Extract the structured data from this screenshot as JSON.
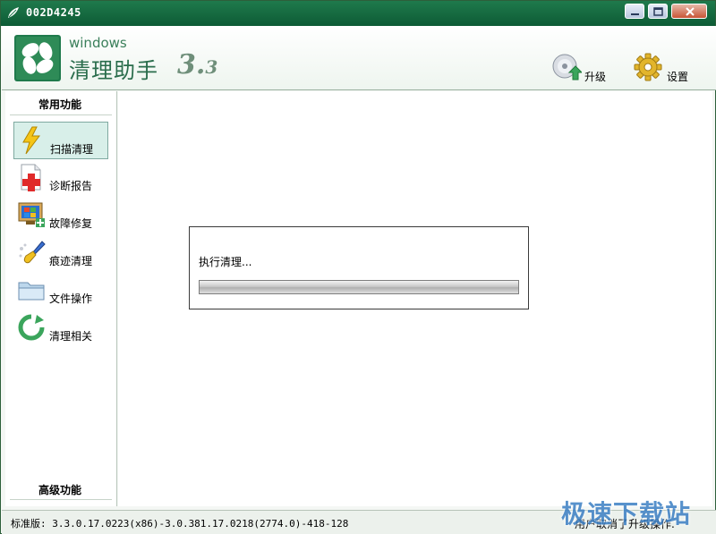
{
  "window": {
    "title": "002D4245"
  },
  "header": {
    "brand_windows": "windows",
    "brand_name": "清理助手",
    "brand_version_major": "3.",
    "brand_version_minor": "3",
    "upgrade_label": "升级",
    "settings_label": "设置"
  },
  "sidebar": {
    "common_header": "常用功能",
    "advanced_header": "高级功能",
    "items": [
      {
        "label": "扫描清理",
        "icon": "lightning-icon",
        "active": true
      },
      {
        "label": "诊断报告",
        "icon": "medical-report-icon",
        "active": false
      },
      {
        "label": "故障修复",
        "icon": "monitor-repair-icon",
        "active": false
      },
      {
        "label": "痕迹清理",
        "icon": "brush-icon",
        "active": false
      },
      {
        "label": "文件操作",
        "icon": "folder-icon",
        "active": false
      },
      {
        "label": "清理相关",
        "icon": "refresh-arrow-icon",
        "active": false
      }
    ]
  },
  "dialog": {
    "message": "执行清理...",
    "progress": 0
  },
  "statusbar": {
    "left": "标准版: 3.3.0.17.0223(x86)-3.0.381.17.0218(2774.0)-418-128",
    "right": "用户取消了升级操作."
  },
  "watermark": {
    "text": "极速下载站"
  },
  "colors": {
    "titlebar": "#0d5b35",
    "accent": "#2a6d4c",
    "active_item": "#d8efe9"
  }
}
